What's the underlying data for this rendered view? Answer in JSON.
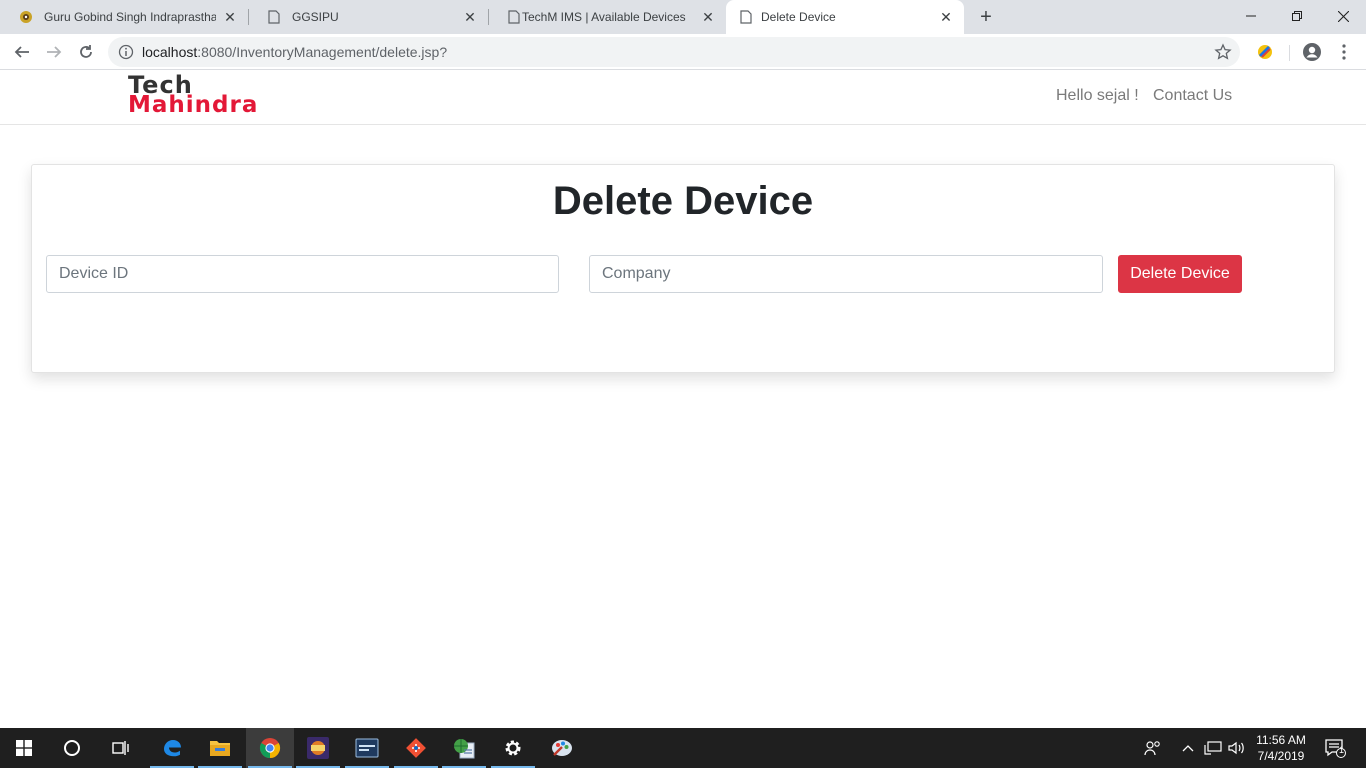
{
  "browser": {
    "tabs": [
      {
        "title": "Guru Gobind Singh Indraprastha",
        "icon": "university-emblem-icon"
      },
      {
        "title": "GGSIPU",
        "icon": "page-icon"
      },
      {
        "title": "TechM IMS | Available Devices",
        "icon": "page-icon"
      },
      {
        "title": "Delete Device",
        "icon": "page-icon"
      }
    ],
    "address": {
      "host": "localhost",
      "rest": ":8080/InventoryManagement/delete.jsp?"
    }
  },
  "site": {
    "logo_line1": "Tech",
    "logo_line2": "Mahindra",
    "nav": {
      "greeting": "Hello sejal !",
      "contact": "Contact Us"
    }
  },
  "form": {
    "heading": "Delete Device",
    "device_id_placeholder": "Device ID",
    "company_placeholder": "Company",
    "submit_label": "Delete Device"
  },
  "taskbar": {
    "time": "11:56 AM",
    "date": "7/4/2019",
    "notification_count": "1"
  },
  "colors": {
    "brand_red": "#e31837",
    "danger_button": "#dc3545"
  }
}
